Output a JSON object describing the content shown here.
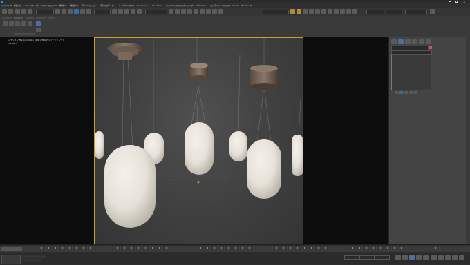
{
  "menu": {
    "items": [
      "ファイル(F)",
      "編集(E)",
      "ツール(T)",
      "グループ(G)",
      "ビュー(V)",
      "作成(C)",
      "修正(M)",
      "アニメーション",
      "グラフエディタ",
      "レンダリング(R)",
      "Substance",
      "Civil View",
      "カスタマイズ(U)",
      "スクリプト(S)",
      "Interactive",
      "コンテンツ",
      "ヘルプ(H)",
      "Arnold",
      "Phoenix FD"
    ]
  },
  "console": {
    "line1": "<コンストVRayCam002> [標準] [既定のシェーディング]",
    "line2": "<VRay>"
  },
  "colors": {
    "accent": "#c9a227",
    "viewport_bg": "#3f3f3f",
    "panel_bg": "#444444",
    "highlight": "#e0457b",
    "select": "#2f6fb2"
  }
}
